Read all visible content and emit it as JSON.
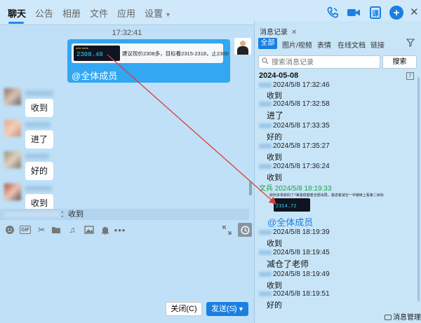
{
  "top_tabs": [
    {
      "label": "聊天",
      "active": true
    },
    {
      "label": "公告"
    },
    {
      "label": "相册"
    },
    {
      "label": "文件"
    },
    {
      "label": "应用"
    },
    {
      "label": "设置"
    }
  ],
  "toolbar_right_icons": [
    "phone-icon",
    "video-icon",
    "ke-icon",
    "plus-icon",
    "close-icon"
  ],
  "chat": {
    "timestamp": "17:32:41",
    "my_message": {
      "card_text": "建议现价2308多，目标看2315-2318，止2300",
      "card_price": "2308.48",
      "mention": "@全体成员"
    },
    "replies": [
      "收到",
      "进了",
      "好的",
      "收到"
    ],
    "quote_bar": "：收到"
  },
  "input_toolbar_icons": [
    "emoji-icon",
    "gif-icon",
    "scissors-icon",
    "folder-icon",
    "music-icon",
    "image-icon",
    "bell-icon",
    "more-icon",
    "expand-icon",
    "history-icon"
  ],
  "buttons": {
    "close": "关闭(C)",
    "send": "发送(S)"
  },
  "history_panel": {
    "title": "消息记录",
    "tabs": [
      "全部",
      "图片/视频",
      "表情",
      "在线文档",
      "链接"
    ],
    "search_placeholder": "搜索消息记录",
    "search_button": "搜索",
    "date_heading": "2024-05-08",
    "records": [
      {
        "time": "2024/5/8 17:32:46",
        "text": "收到"
      },
      {
        "time": "2024/5/8 17:32:58",
        "text": "进了"
      },
      {
        "time": "2024/5/8 17:33:35",
        "text": "好的"
      },
      {
        "time": "2024/5/8 17:35:27",
        "text": "收到"
      },
      {
        "time": "2024/5/8 17:36:24",
        "text": "收到"
      },
      {
        "time": "2024/5/8 18:19:33",
        "name": "文兵"
      },
      {
        "time": "2024/5/8 18:19:39",
        "text": "收到"
      },
      {
        "time": "2024/5/8 18:19:45",
        "text": "减仓了老师"
      },
      {
        "time": "2024/5/8 18:19:49",
        "text": "收到"
      },
      {
        "time": "2024/5/8 18:19:51",
        "text": "好的"
      }
    ],
    "card_text": "获利多单获利了7美金稳健者全部出局，激进者减仓一半继续上看第二目标",
    "card_price": "2314.72",
    "mention": "@全体成员",
    "footer": "消息管理"
  }
}
